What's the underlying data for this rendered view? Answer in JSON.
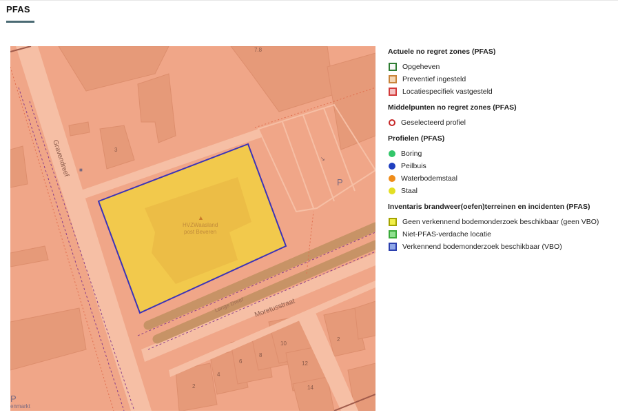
{
  "page": {
    "title": "PFAS"
  },
  "map": {
    "labels": {
      "street_1": "Gravendreef",
      "street_2": "Moretusstraat",
      "street_3": "Lange Dreef",
      "site_name_1": "HVZWaasland",
      "site_name_2": "post Beveren",
      "parking_1": "P",
      "parking_2": "P",
      "partial_text": "enmarkt",
      "house_78": "7.8",
      "house_3": "3",
      "house_2a": "2",
      "house_4": "4",
      "house_6": "6",
      "house_8": "8",
      "house_10": "10",
      "house_12": "12",
      "house_14": "14",
      "house_2b": "2"
    }
  },
  "legend": {
    "sections": [
      {
        "title": "Actuele no regret zones (PFAS)",
        "items": [
          {
            "label": "Opgeheven",
            "symbol": "square",
            "stroke": "#2e7d32",
            "fill": "#f7f7f7"
          },
          {
            "label": "Preventief ingesteld",
            "symbol": "square",
            "stroke": "#c8843a",
            "fill": "#f4d7b5"
          },
          {
            "label": "Locatiespecifiek vastgesteld",
            "symbol": "square",
            "stroke": "#d23a3a",
            "fill": "#f4c1c1"
          }
        ]
      },
      {
        "title": "Middelpunten no regret zones (PFAS)",
        "items": [
          {
            "label": "Geselecteerd profiel",
            "symbol": "circle-outline",
            "stroke": "#c62828",
            "fill": "#ffffff"
          }
        ]
      },
      {
        "title": "Profielen (PFAS)",
        "items": [
          {
            "label": "Boring",
            "symbol": "circle",
            "stroke": "#33c66a",
            "fill": "#33c66a"
          },
          {
            "label": "Peilbuis",
            "symbol": "circle",
            "stroke": "#1f3fbf",
            "fill": "#1f3fbf"
          },
          {
            "label": "Waterbodemstaal",
            "symbol": "circle",
            "stroke": "#ef8c1a",
            "fill": "#ef8c1a"
          },
          {
            "label": "Staal",
            "symbol": "circle",
            "stroke": "#e3df24",
            "fill": "#e3df24"
          }
        ]
      },
      {
        "title": "Inventaris brandweer(oefen)terreinen en incidenten (PFAS)",
        "items": [
          {
            "label": "Geen verkennend bodemonderzoek beschikbaar (geen VBO)",
            "symbol": "square",
            "stroke": "#a3a300",
            "fill": "#f1ef4a"
          },
          {
            "label": "Niet-PFAS-verdache locatie",
            "symbol": "square",
            "stroke": "#3aaa3a",
            "fill": "#8fe08f"
          },
          {
            "label": "Verkennend bodemonderzoek beschikbaar (VBO)",
            "symbol": "square",
            "stroke": "#2b3fae",
            "fill": "#8fa7e8"
          }
        ]
      }
    ]
  },
  "colors": {
    "map_base": "#f0a688",
    "building": "#e69a79",
    "road": "#f6bfa5",
    "site_fill": "#f2c94c",
    "site_stroke": "#3b33b8",
    "path_band": "#c79366",
    "title_underline": "#4a6a73"
  }
}
